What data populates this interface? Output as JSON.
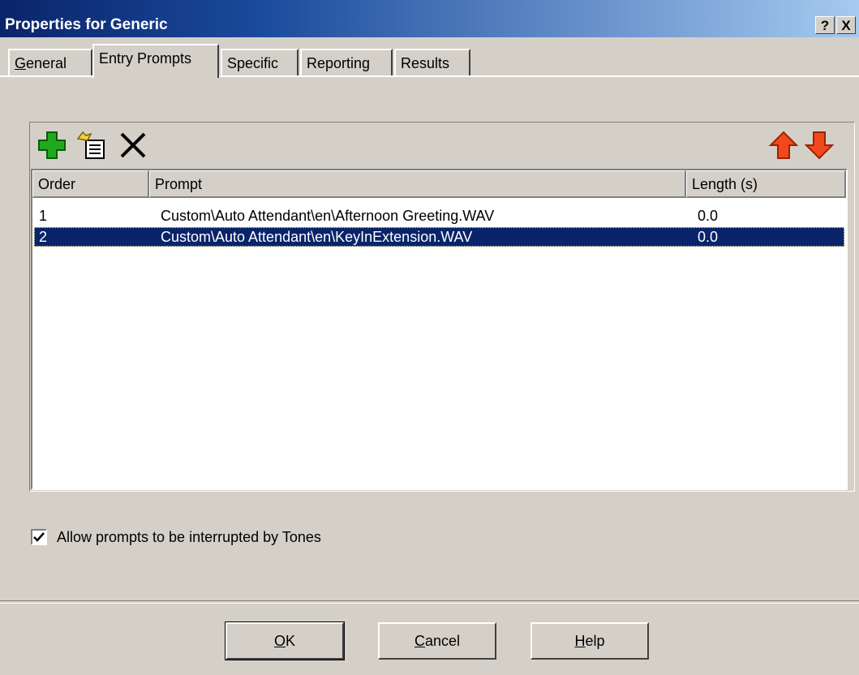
{
  "window": {
    "title": "Properties for Generic",
    "help_btn": "?",
    "close_btn": "X"
  },
  "tabs": [
    {
      "label_u": "G",
      "label_rest": "eneral",
      "active": false
    },
    {
      "label_u": "",
      "label_rest": "Entry Prompts",
      "active": true
    },
    {
      "label_u": "",
      "label_rest": "Specific",
      "active": false
    },
    {
      "label_u": "",
      "label_rest": "Reporting",
      "active": false
    },
    {
      "label_u": "",
      "label_rest": "Results",
      "active": false
    }
  ],
  "toolbar": {
    "icons": [
      "add-icon",
      "edit-prompt-icon",
      "delete-icon",
      "move-up-icon",
      "move-down-icon"
    ],
    "colors": {
      "add": "#1fa91f",
      "move": "#f04a1c"
    }
  },
  "list": {
    "columns": [
      "Order",
      "Prompt",
      "Length (s)"
    ],
    "rows": [
      {
        "order": "1",
        "prompt": "Custom\\Auto Attendant\\en\\Afternoon Greeting.WAV",
        "length": "0.0",
        "selected": false
      },
      {
        "order": "2",
        "prompt": "Custom\\Auto Attendant\\en\\KeyInExtension.WAV",
        "length": "0.0",
        "selected": true
      }
    ]
  },
  "options": {
    "interrupt_label": "Allow prompts to be interrupted by Tones",
    "interrupt_checked": true
  },
  "buttons": {
    "ok_u": "O",
    "ok_rest": "K",
    "cancel_u": "C",
    "cancel_rest": "ancel",
    "help_u": "H",
    "help_rest": "elp"
  },
  "colors": {
    "face": "#d4d0c8",
    "title_start": "#0a246a",
    "selection": "#0a246a"
  }
}
